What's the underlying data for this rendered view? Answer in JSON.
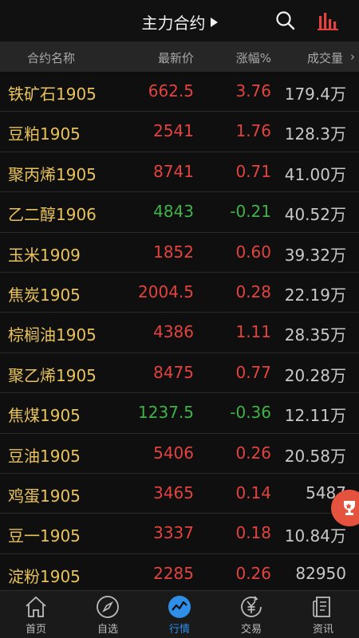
{
  "nav": {
    "title": "主力合约",
    "accent": "#e2433f"
  },
  "table": {
    "headers": {
      "name": "合约名称",
      "price": "最新价",
      "change": "涨幅%",
      "volume": "成交量"
    },
    "rows": [
      {
        "name": "铁矿石1905",
        "price": "662.5",
        "change": "3.76",
        "volume": "179.4万",
        "dir": "up"
      },
      {
        "name": "豆粕1905",
        "price": "2541",
        "change": "1.76",
        "volume": "128.3万",
        "dir": "up"
      },
      {
        "name": "聚丙烯1905",
        "price": "8741",
        "change": "0.71",
        "volume": "41.00万",
        "dir": "up"
      },
      {
        "name": "乙二醇1906",
        "price": "4843",
        "change": "-0.21",
        "volume": "40.52万",
        "dir": "down"
      },
      {
        "name": "玉米1909",
        "price": "1852",
        "change": "0.60",
        "volume": "39.32万",
        "dir": "up"
      },
      {
        "name": "焦炭1905",
        "price": "2004.5",
        "change": "0.28",
        "volume": "22.19万",
        "dir": "up"
      },
      {
        "name": "棕榈油1905",
        "price": "4386",
        "change": "1.11",
        "volume": "28.35万",
        "dir": "up"
      },
      {
        "name": "聚乙烯1905",
        "price": "8475",
        "change": "0.77",
        "volume": "20.28万",
        "dir": "up"
      },
      {
        "name": "焦煤1905",
        "price": "1237.5",
        "change": "-0.36",
        "volume": "12.11万",
        "dir": "down"
      },
      {
        "name": "豆油1905",
        "price": "5406",
        "change": "0.26",
        "volume": "20.58万",
        "dir": "up"
      },
      {
        "name": "鸡蛋1905",
        "price": "3465",
        "change": "0.14",
        "volume": "5487",
        "dir": "up"
      },
      {
        "name": "豆一1905",
        "price": "3337",
        "change": "0.18",
        "volume": "10.84万",
        "dir": "up"
      },
      {
        "name": "淀粉1905",
        "price": "2285",
        "change": "0.26",
        "volume": "82950",
        "dir": "up"
      }
    ]
  },
  "tabs": [
    {
      "label": "首页",
      "icon": "home-icon"
    },
    {
      "label": "自选",
      "icon": "compass-icon"
    },
    {
      "label": "行情",
      "icon": "market-chart-icon",
      "active": true
    },
    {
      "label": "交易",
      "icon": "yen-exchange-icon"
    },
    {
      "label": "资讯",
      "icon": "news-document-icon"
    }
  ],
  "colors": {
    "up": "#e2433f",
    "down": "#3fb24a",
    "name": "#e8c25a",
    "tab_active": "#2f8fe8"
  }
}
